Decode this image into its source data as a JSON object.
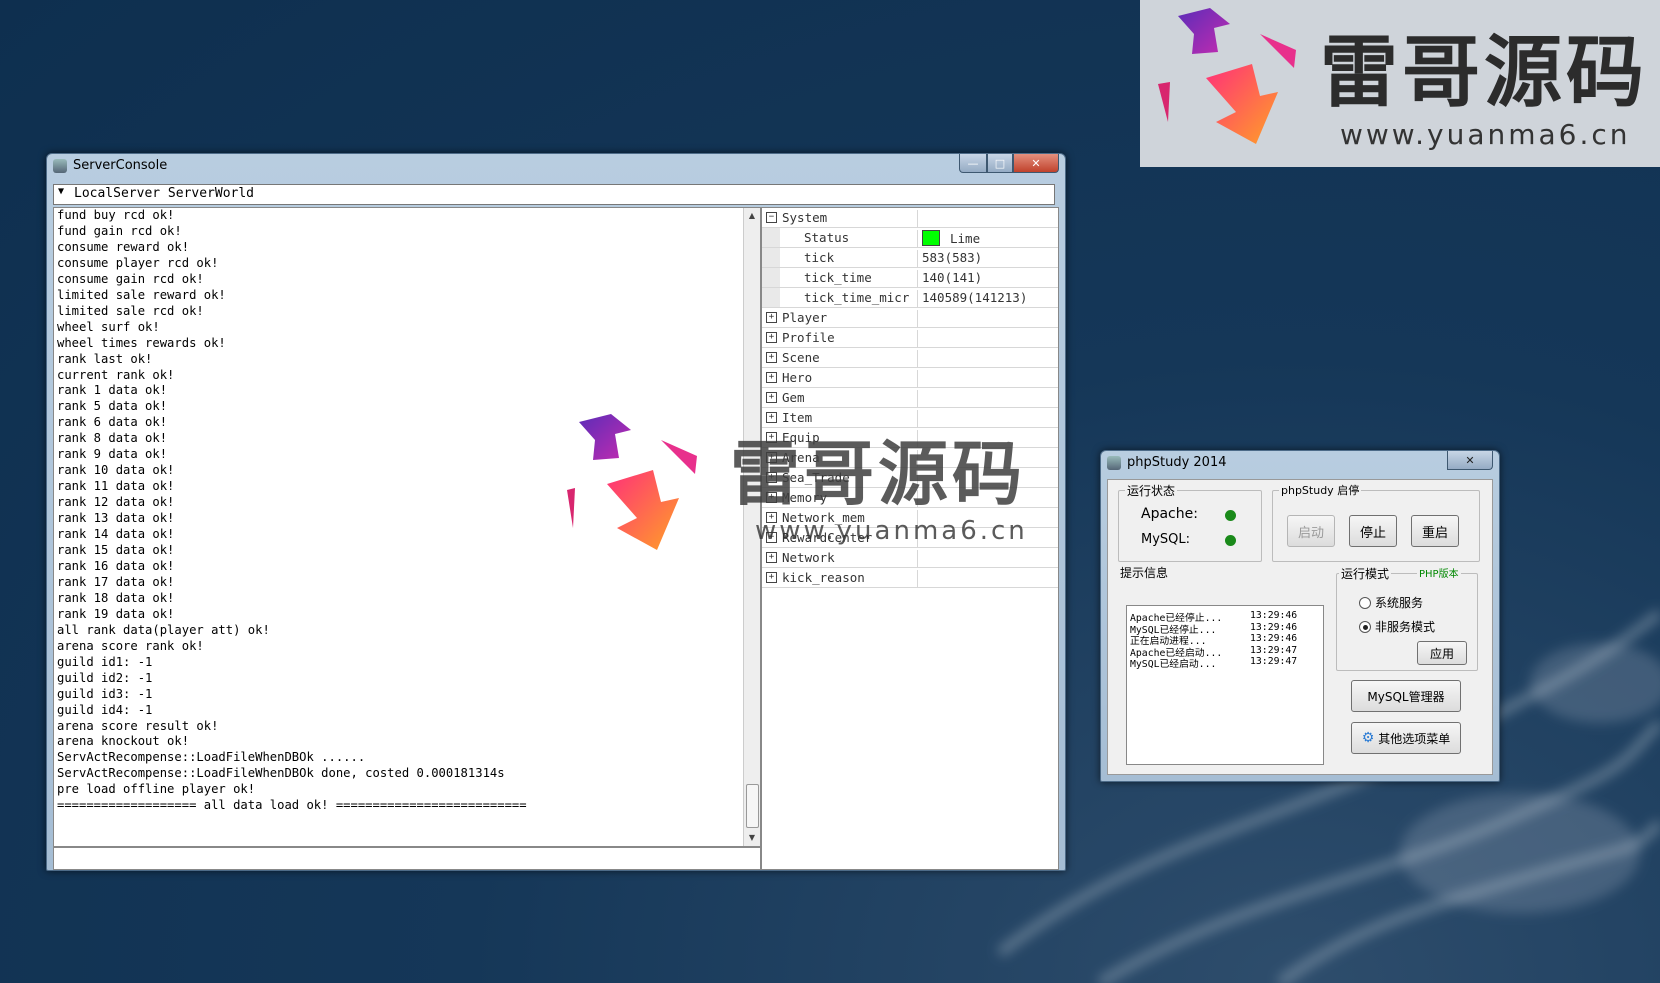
{
  "logo": {
    "title": "雷哥源码",
    "url": "www.yuanma6.cn"
  },
  "watermark": {
    "title": "雷哥源码",
    "url": "www.yuanma6.cn"
  },
  "server_console": {
    "title": "ServerConsole",
    "controls": {
      "min": "—",
      "max": "□",
      "close": "✕"
    },
    "combo_value": "LocalServer ServerWorld",
    "log_lines": [
      "fund buy rcd ok!",
      "fund gain rcd ok!",
      "consume reward ok!",
      "consume player rcd ok!",
      "consume gain rcd ok!",
      "limited sale reward ok!",
      "limited sale rcd ok!",
      "wheel surf ok!",
      "wheel times rewards ok!",
      "rank last ok!",
      "current rank ok!",
      "rank 1 data ok!",
      "rank 5 data ok!",
      "rank 6 data ok!",
      "rank 8 data ok!",
      "rank 9 data ok!",
      "rank 10 data ok!",
      "rank 11 data ok!",
      "rank 12 data ok!",
      "rank 13 data ok!",
      "rank 14 data ok!",
      "rank 15 data ok!",
      "rank 16 data ok!",
      "rank 17 data ok!",
      "rank 18 data ok!",
      "rank 19 data ok!",
      "all rank data(player att) ok!",
      "arena score rank ok!",
      "guild id1: -1",
      "guild id2: -1",
      "guild id3: -1",
      "guild id4: -1",
      "arena score result ok!",
      "arena knockout ok!",
      "ServActRecompense::LoadFileWhenDBOk ......",
      "ServActRecompense::LoadFileWhenDBOk done, costed 0.000181314s",
      "pre load offline player ok!",
      "=================== all data load ok! =========================="
    ],
    "tree": [
      {
        "name": "System",
        "expander": "−",
        "child": false,
        "value": ""
      },
      {
        "name": "Status",
        "expander": "",
        "child": true,
        "value": "Lime",
        "status": true
      },
      {
        "name": "tick",
        "expander": "",
        "child": true,
        "value": "583(583)"
      },
      {
        "name": "tick_time",
        "expander": "",
        "child": true,
        "value": "140(141)"
      },
      {
        "name": "tick_time_micr",
        "expander": "",
        "child": true,
        "value": "140589(141213)"
      },
      {
        "name": "Player",
        "expander": "+",
        "child": false,
        "value": ""
      },
      {
        "name": "Profile",
        "expander": "+",
        "child": false,
        "value": ""
      },
      {
        "name": "Scene",
        "expander": "+",
        "child": false,
        "value": ""
      },
      {
        "name": "Hero",
        "expander": "+",
        "child": false,
        "value": ""
      },
      {
        "name": "Gem",
        "expander": "+",
        "child": false,
        "value": ""
      },
      {
        "name": "Item",
        "expander": "+",
        "child": false,
        "value": ""
      },
      {
        "name": "Equip",
        "expander": "+",
        "child": false,
        "value": ""
      },
      {
        "name": "Arena",
        "expander": "+",
        "child": false,
        "value": ""
      },
      {
        "name": "Sea_Trade",
        "expander": "+",
        "child": false,
        "value": ""
      },
      {
        "name": "Memory",
        "expander": "+",
        "child": false,
        "value": ""
      },
      {
        "name": "Network_mem",
        "expander": "+",
        "child": false,
        "value": ""
      },
      {
        "name": "RewardCenter",
        "expander": "+",
        "child": false,
        "value": ""
      },
      {
        "name": "Network",
        "expander": "+",
        "child": false,
        "value": ""
      },
      {
        "name": "kick_reason",
        "expander": "+",
        "child": false,
        "value": ""
      }
    ],
    "status_color": "#00ff00"
  },
  "phpstudy": {
    "title": "phpStudy 2014",
    "close": "✕",
    "run_status_caption": "运行状态",
    "apache_label": "Apache:",
    "mysql_label": "MySQL:",
    "start_stop_caption": "phpStudy 启停",
    "start_btn": "启动",
    "stop_btn": "停止",
    "restart_btn": "重启",
    "info_caption": "提示信息",
    "messages": [
      {
        "text": "Apache已经停止...",
        "time": "13:29:46"
      },
      {
        "text": "MySQL已经停止...",
        "time": "13:29:46"
      },
      {
        "text": "正在启动进程...",
        "time": "13:29:46"
      },
      {
        "text": "Apache已经启动...",
        "time": "13:29:47"
      },
      {
        "text": "MySQL已经启动...",
        "time": "13:29:47"
      }
    ],
    "mode_caption": "运行模式",
    "php_version_link": "PHP版本",
    "mode_service": "系统服务",
    "mode_nonservice": "非服务模式",
    "selected_mode": "非服务模式",
    "apply_btn": "应用",
    "mysql_mgr_btn": "MySQL管理器",
    "other_menu_btn": "其他选项菜单",
    "status_dot_color": "#1a8a1a"
  }
}
